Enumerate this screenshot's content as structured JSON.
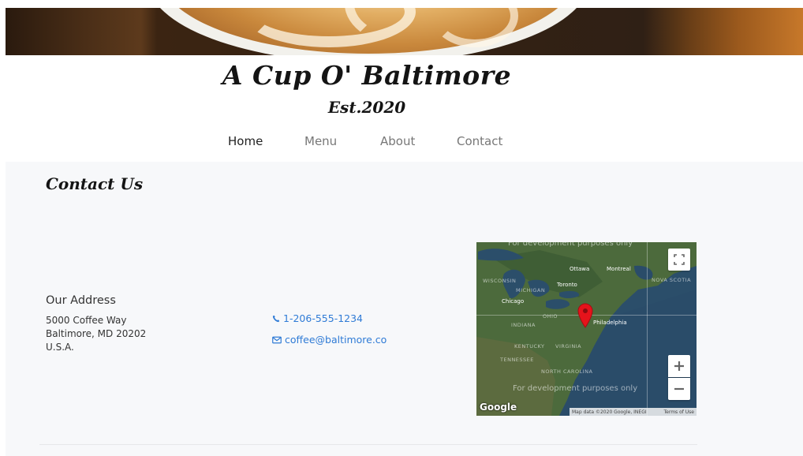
{
  "header": {
    "title": "A Cup O' Baltimore",
    "subtitle": "Est.2020"
  },
  "nav": {
    "items": [
      {
        "label": "Home",
        "active": true
      },
      {
        "label": "Menu",
        "active": false
      },
      {
        "label": "About",
        "active": false
      },
      {
        "label": "Contact",
        "active": false
      }
    ]
  },
  "contact": {
    "heading": "Contact Us",
    "address_heading": "Our Address",
    "address_lines": [
      "5000 Coffee Way",
      "Baltimore, MD 20202",
      "U.S.A."
    ],
    "phone": "1-206-555-1234",
    "email": "coffee@baltimore.co",
    "link_color": "#2f7bd6",
    "icons": {
      "phone": "phone-icon",
      "email": "envelope-icon"
    }
  },
  "map": {
    "watermark": "For development purposes only",
    "logo": "Google",
    "attribution": "Map data ©2020 Google, INEGI",
    "terms": "Terms of Use",
    "cities": [
      "Ottawa",
      "Montreal",
      "Toronto",
      "Chicago",
      "Philadelphia"
    ],
    "states": [
      "WISCONSIN",
      "MICHIGAN",
      "INDIANA",
      "OHIO",
      "KENTUCKY",
      "VIRGINIA",
      "TENNESSEE",
      "NORTH CAROLINA",
      "NOVA SCOTIA"
    ],
    "controls": {
      "fullscreen": "fullscreen-icon",
      "zoom_in": "plus-icon",
      "zoom_out": "minus-icon"
    },
    "marker_color": "#e5131b"
  }
}
